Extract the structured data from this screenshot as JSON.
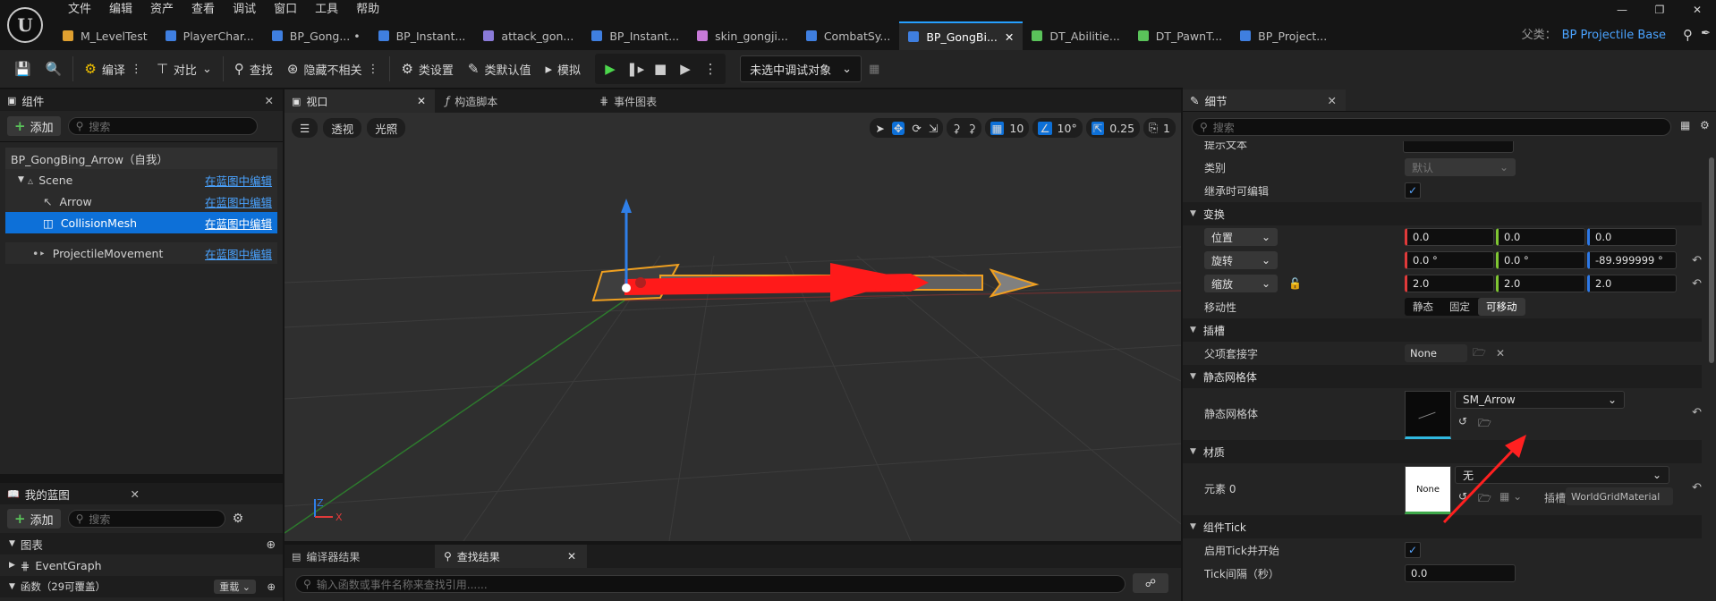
{
  "menu": [
    "文件",
    "编辑",
    "资产",
    "查看",
    "调试",
    "窗口",
    "工具",
    "帮助"
  ],
  "tabs": [
    {
      "label": "M_LevelTest",
      "icon": "material-icon",
      "color": "#e0a030"
    },
    {
      "label": "PlayerChar...",
      "icon": "blueprint-icon",
      "color": "#3f7fe0"
    },
    {
      "label": "BP_Gong... •",
      "icon": "blueprint-icon",
      "color": "#3f7fe0"
    },
    {
      "label": "BP_Instant...",
      "icon": "blueprint-icon",
      "color": "#3f7fe0"
    },
    {
      "label": "attack_gon...",
      "icon": "animation-icon",
      "color": "#8a7ad8"
    },
    {
      "label": "BP_Instant...",
      "icon": "blueprint-icon",
      "color": "#3f7fe0"
    },
    {
      "label": "skin_gongji...",
      "icon": "skeleton-icon",
      "color": "#c77ad8"
    },
    {
      "label": "CombatSy...",
      "icon": "blueprint-icon",
      "color": "#3f7fe0"
    },
    {
      "label": "BP_GongBi...",
      "icon": "blueprint-icon",
      "color": "#3f7fe0",
      "active": true
    },
    {
      "label": "DT_Abilitie...",
      "icon": "datatable-icon",
      "color": "#5ac35a"
    },
    {
      "label": "DT_PawnT...",
      "icon": "datatable-icon",
      "color": "#5ac35a"
    },
    {
      "label": "BP_Project...",
      "icon": "blueprint-icon",
      "color": "#3f7fe0"
    }
  ],
  "parent": {
    "label": "父类：",
    "value": "BP Projectile Base"
  },
  "toolbar": {
    "compile": "编译",
    "diff": "对比",
    "find": "查找",
    "hide_unrelated": "隐藏不相关",
    "class_settings": "类设置",
    "class_defaults": "类默认值",
    "simulate": "模拟",
    "debug_object": "未选中调试对象"
  },
  "components": {
    "title": "组件",
    "add": "添加",
    "search_placeholder": "搜索",
    "root": "BP_GongBing_Arrow（自我）",
    "items": [
      {
        "label": "Scene",
        "edit": "在蓝图中编辑"
      },
      {
        "label": "Arrow",
        "edit": "在蓝图中编辑"
      },
      {
        "label": "CollisionMesh",
        "edit": "在蓝图中编辑",
        "selected": true
      },
      {
        "label": "ProjectileMovement",
        "edit": "在蓝图中编辑"
      }
    ]
  },
  "my_blueprint": {
    "title": "我的蓝图",
    "add": "添加",
    "search_placeholder": "搜索",
    "graphs": "图表",
    "event_graph": "EventGraph",
    "functions": "函数（29可覆盖）",
    "override": "重载"
  },
  "viewport_tabs": {
    "viewport": "视口",
    "construction": "构造脚本",
    "event_graph": "事件图表"
  },
  "viewport": {
    "perspective": "透视",
    "lighting": "光照",
    "grid": "10",
    "angle": "10°",
    "scale": "0.25",
    "camera": "1"
  },
  "bottom_tabs": {
    "compiler": "编译器结果",
    "find": "查找结果",
    "find_placeholder": "输入函数或事件名称来查找引用......"
  },
  "details": {
    "title": "细节",
    "search_placeholder": "搜索",
    "cut_label": "提示文本",
    "category_label": "类别",
    "category_value": "默认",
    "editable_label": "继承时可编辑",
    "transform": "变换",
    "location": "位置",
    "loc": [
      "0.0",
      "0.0",
      "0.0"
    ],
    "rotation": "旋转",
    "rot": [
      "0.0 °",
      "0.0 °",
      "-89.999999 °"
    ],
    "scale": "缩放",
    "scl": [
      "2.0",
      "2.0",
      "2.0"
    ],
    "mobility": "移动性",
    "mobility_opts": [
      "静态",
      "固定",
      "可移动"
    ],
    "sockets": "插槽",
    "parent_socket": "父项套接字",
    "socket_value": "None",
    "static_mesh_section": "静态网格体",
    "static_mesh": "静态网格体",
    "mesh_value": "SM_Arrow",
    "materials": "材质",
    "element0": "元素 0",
    "mat_thumb": "None",
    "mat_value": "无",
    "slot_label": "插槽",
    "slot_value": "WorldGridMaterial",
    "tick_section": "组件Tick",
    "tick_enable": "启用Tick并开始",
    "tick_interval": "Tick间隔（秒）",
    "tick_value": "0.0"
  },
  "colors": {
    "accent": "#0d70d8",
    "link": "#4aa3ff",
    "arrow_red": "#ff1a1a",
    "play_green": "#4cd64c"
  }
}
